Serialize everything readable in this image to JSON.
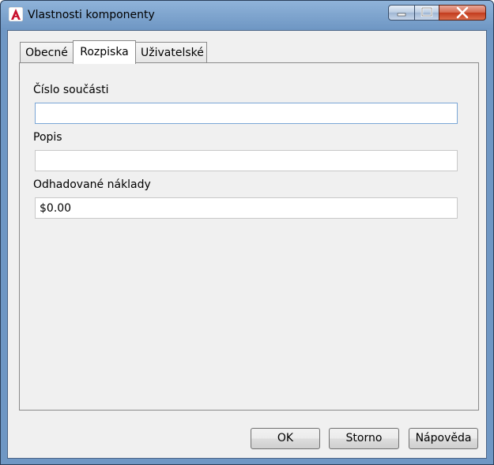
{
  "window": {
    "title": "Vlastnosti komponenty",
    "icon": "autocad-a-icon",
    "controls": [
      "minimize-icon",
      "maximize-icon",
      "close-icon"
    ]
  },
  "tabs": [
    {
      "label": "Obecné",
      "active": false
    },
    {
      "label": "Rozpiska",
      "active": true
    },
    {
      "label": "Uživatelské",
      "active": false
    }
  ],
  "form": {
    "part_number": {
      "label": "Číslo součásti",
      "value": ""
    },
    "description": {
      "label": "Popis",
      "value": ""
    },
    "estimated_cost": {
      "label": "Odhadované náklady",
      "value": "$0.00"
    }
  },
  "buttons": {
    "ok": "OK",
    "cancel": "Storno",
    "help": "Nápověda"
  },
  "colors": {
    "accent_red": "#c8102e",
    "focus_border": "#7aa6d6"
  }
}
